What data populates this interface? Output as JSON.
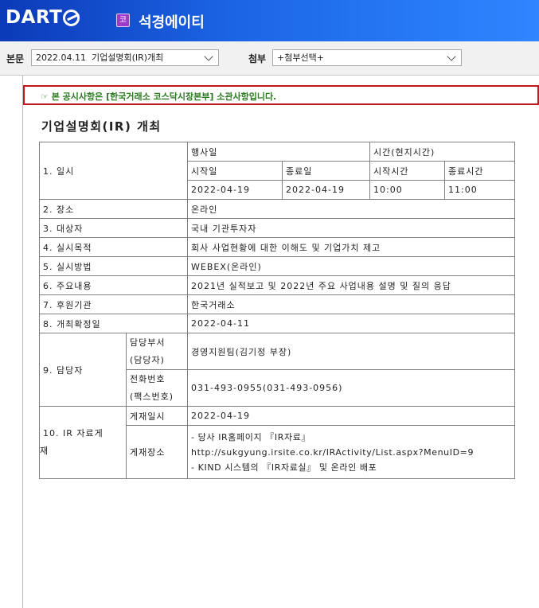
{
  "header": {
    "logo": "DART",
    "corp_badge": "코",
    "corp_name": "석경에이티"
  },
  "toolbar": {
    "main_label": "본문",
    "main_select": "2022.04.11  기업설명회(IR)개최",
    "attach_label": "첨부",
    "attach_select": "+첨부선택+"
  },
  "notice": "☞ 본 공시사항은 [한국거래소 코스닥시장본부] 소관사항입니다.",
  "doc_title": "기업설명회(IR) 개최",
  "table": {
    "r1_label": "1. 일시",
    "event_date_header": "행사일",
    "time_header": "시간(현지시간)",
    "start_date_header": "시작일",
    "end_date_header": "종료일",
    "start_time_header": "시작시간",
    "end_time_header": "종료시간",
    "start_date": "2022-04-19",
    "end_date": "2022-04-19",
    "start_time": "10:00",
    "end_time": "11:00",
    "r2_label": "2. 장소",
    "r2_value": "온라인",
    "r3_label": "3. 대상자",
    "r3_value": "국내 기관투자자",
    "r4_label": "4. 실시목적",
    "r4_value": "회사 사업현황에 대한 이해도 및 기업가치 제고",
    "r5_label": "5. 실시방법",
    "r5_value": "WEBEX(온라인)",
    "r6_label": "6. 주요내용",
    "r6_value": "2021년 실적보고 및 2022년 주요 사업내용 설명 및 질의 응답",
    "r7_label": "7. 후원기관",
    "r7_value": "한국거래소",
    "r8_label": "8. 개최확정일",
    "r8_value": "2022-04-11",
    "r9_label": "9. 담당자",
    "dept_label_1": "담당부서",
    "dept_label_2": "(담당자)",
    "dept_value": "경영지원팀(김기정 부장)",
    "phone_label_1": "전화번호",
    "phone_label_2": "(팩스번호)",
    "phone_value": "031-493-0955(031-493-0956)",
    "r10_label_1": "10. IR 자료게",
    "r10_label_2": "재",
    "post_date_label": "게재일시",
    "post_date_value": "2022-04-19",
    "post_place_label": "게재장소",
    "post_place_line1": "- 당사 IR홈페이지 『IR자료』",
    "post_place_line2": "http://sukgyung.irsite.co.kr/IRActivity/List.aspx?MenuID=9",
    "post_place_line3": "- KIND 시스템의 『IR자료실』 및 온라인 배포"
  }
}
